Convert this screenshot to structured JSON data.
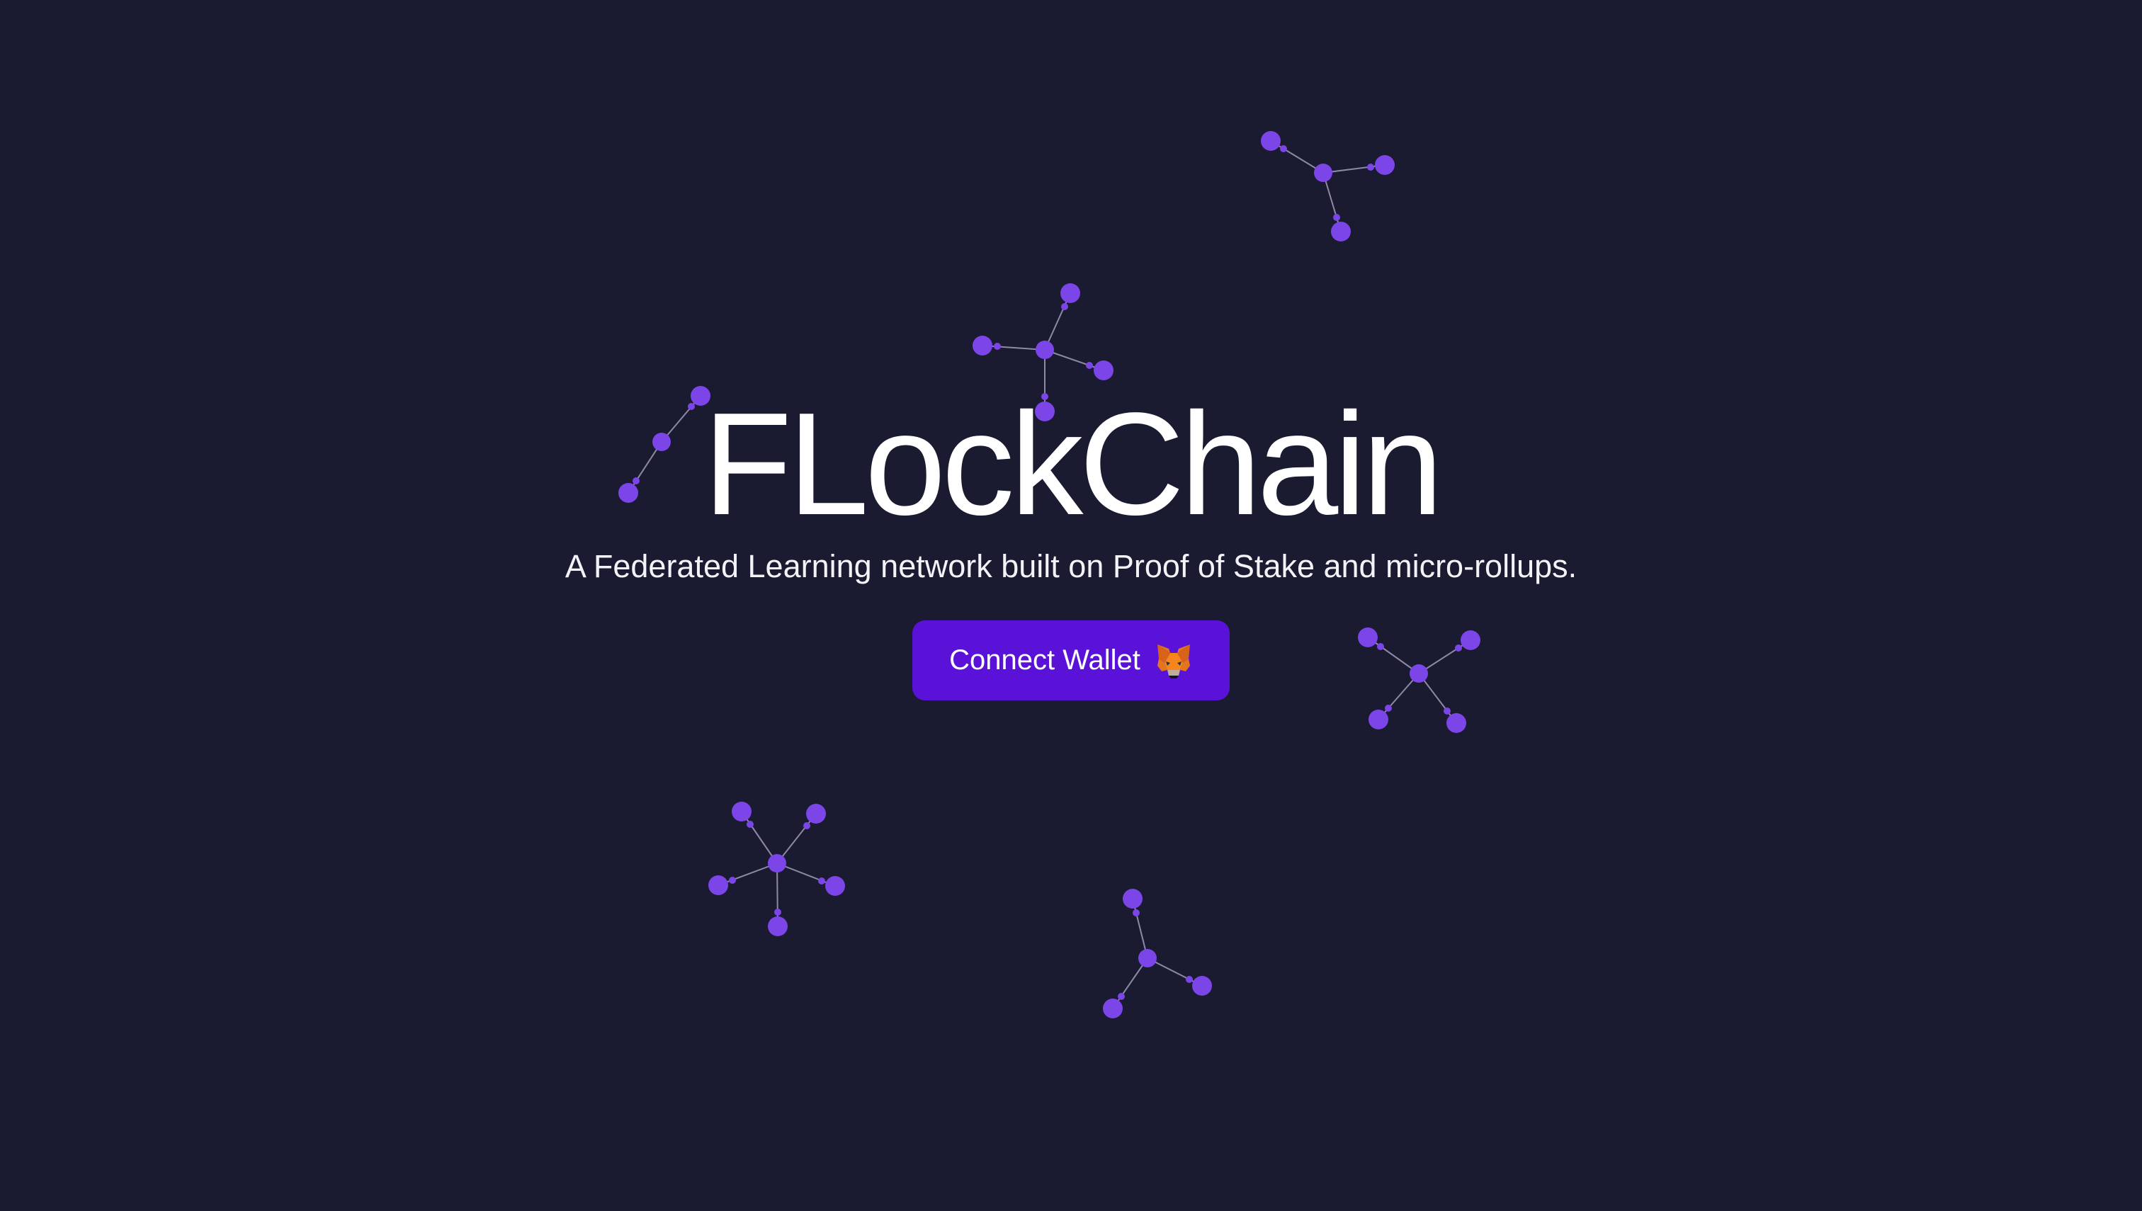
{
  "hero": {
    "title": "FLockChain",
    "subtitle": "A Federated Learning network built on Proof of Stake and micro-rollups."
  },
  "connect_button": {
    "label": "Connect Wallet",
    "icon": "metamask-fox-icon"
  },
  "colors": {
    "background": "#1a1b31",
    "node": "#7b45e8",
    "edge": "#8d8aa8",
    "button": "#5b12d8",
    "text": "#ffffff"
  }
}
